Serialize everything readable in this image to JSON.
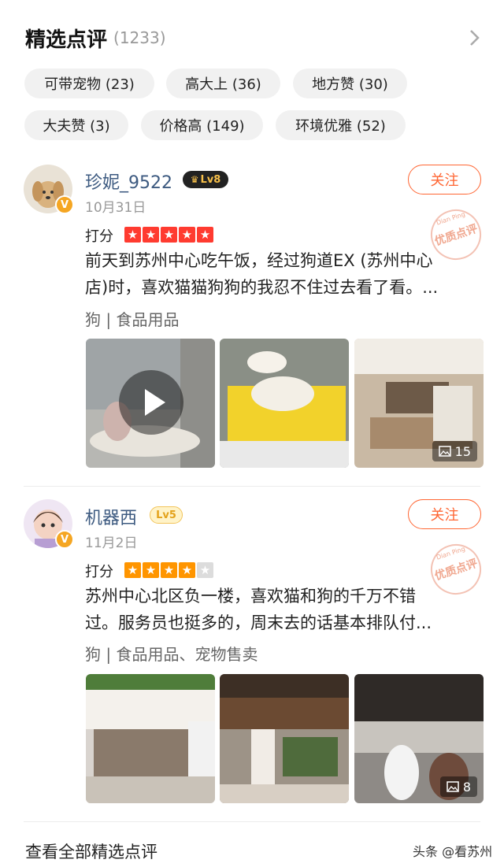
{
  "header": {
    "title": "精选点评",
    "count": "(1233)"
  },
  "tags": [
    "可带宠物 (23)",
    "高大上 (36)",
    "地方赞 (30)",
    "大夫赞 (3)",
    "价格高 (149)",
    "环境优雅 (52)"
  ],
  "reviews": [
    {
      "username": "珍妮_9522",
      "level": "Lv8",
      "date": "10月31日",
      "follow_label": "关注",
      "stamp": "优质点评",
      "stamp_small": "Dian Ping",
      "score_label": "打分",
      "rating": 5,
      "content_lines": [
        "前天到苏州中心吃午饭，经过狗道EX (苏州中心",
        "店)时，喜欢猫猫狗狗的我忍不住过去看了看。..."
      ],
      "categories": "狗 | 食品用品",
      "photo_count": "15"
    },
    {
      "username": "机器西",
      "level": "Lv5",
      "date": "11月2日",
      "follow_label": "关注",
      "stamp": "优质点评",
      "stamp_small": "Dian Ping",
      "score_label": "打分",
      "rating": 4,
      "content_lines": [
        "苏州中心北区负一楼，喜欢猫和狗的千万不错",
        "过。服务员也挺多的，周末去的话基本排队付..."
      ],
      "categories": "狗 | 食品用品、宠物售卖",
      "photo_count": "8"
    }
  ],
  "footer": {
    "view_all": "查看全部精选点评",
    "watermark": "头条 @看苏州"
  },
  "colors": {
    "accent": "#ff6633",
    "star_on": "#ff3b30",
    "star_on_2": "#ff9500",
    "username": "#3d5a80"
  }
}
